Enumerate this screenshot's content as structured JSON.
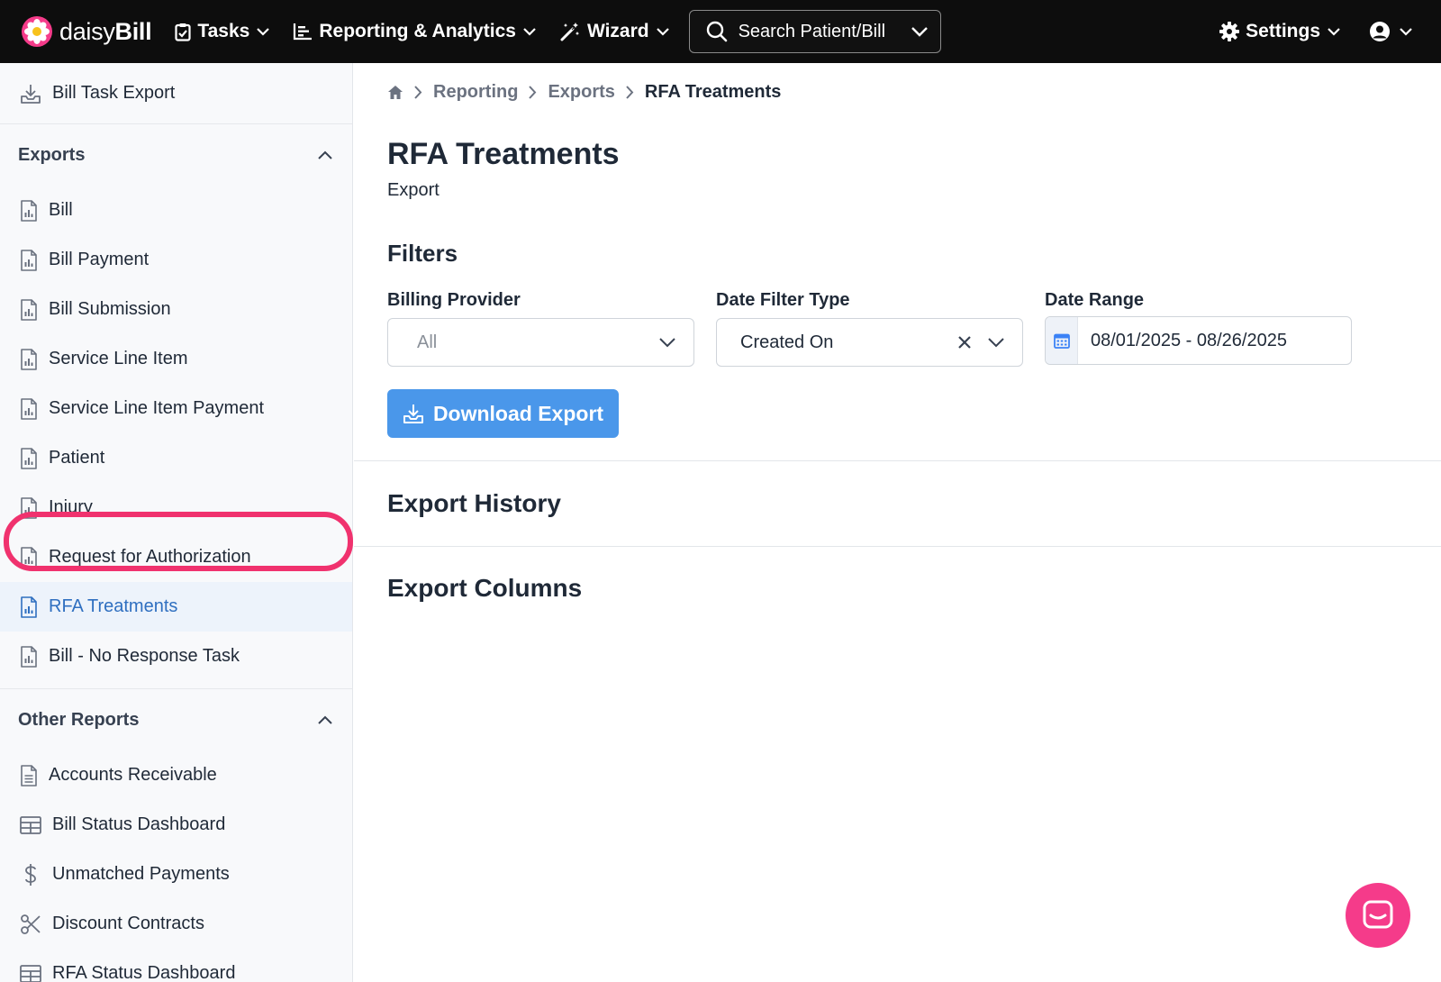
{
  "brand": {
    "name_light": "daisy",
    "name_bold": "Bill",
    "logo_icon": "daisy-flower-icon"
  },
  "topnav": {
    "tasks": "Tasks",
    "reporting": "Reporting & Analytics",
    "wizard": "Wizard",
    "search_label": "Search Patient/Bill",
    "settings": "Settings"
  },
  "sidebar": {
    "top_item": "Bill Task Export",
    "exports_heading": "Exports",
    "exports": [
      {
        "label": "Bill",
        "icon": "report-file-icon"
      },
      {
        "label": "Bill Payment",
        "icon": "report-file-icon"
      },
      {
        "label": "Bill Submission",
        "icon": "report-file-icon"
      },
      {
        "label": "Service Line Item",
        "icon": "report-file-icon"
      },
      {
        "label": "Service Line Item Payment",
        "icon": "report-file-icon"
      },
      {
        "label": "Patient",
        "icon": "report-file-icon"
      },
      {
        "label": "Injury",
        "icon": "report-file-icon"
      },
      {
        "label": "Request for Authorization",
        "icon": "report-file-icon"
      },
      {
        "label": "RFA Treatments",
        "icon": "report-file-icon",
        "active": true
      },
      {
        "label": "Bill - No Response Task",
        "icon": "report-file-icon"
      }
    ],
    "other_heading": "Other Reports",
    "other": [
      {
        "label": "Accounts Receivable",
        "icon": "document-icon"
      },
      {
        "label": "Bill Status Dashboard",
        "icon": "table-icon"
      },
      {
        "label": "Unmatched Payments",
        "icon": "dollar-icon"
      },
      {
        "label": "Discount Contracts",
        "icon": "scissors-icon"
      },
      {
        "label": "RFA Status Dashboard",
        "icon": "table-icon"
      }
    ]
  },
  "breadcrumb": {
    "items": [
      "Reporting",
      "Exports"
    ],
    "current": "RFA Treatments"
  },
  "page": {
    "title": "RFA Treatments",
    "subtitle": "Export"
  },
  "filters": {
    "heading": "Filters",
    "billing_provider": {
      "label": "Billing Provider",
      "value": "All"
    },
    "date_filter_type": {
      "label": "Date Filter Type",
      "value": "Created On"
    },
    "date_range": {
      "label": "Date Range",
      "value": "08/01/2025 - 08/26/2025"
    }
  },
  "download_button": "Download Export",
  "sections": {
    "history": "Export History",
    "columns": "Export Columns"
  },
  "colors": {
    "accent": "#4a97ea",
    "active_link": "#2f6fc0",
    "highlight": "#f0326e",
    "chat": "#f53b8a"
  }
}
